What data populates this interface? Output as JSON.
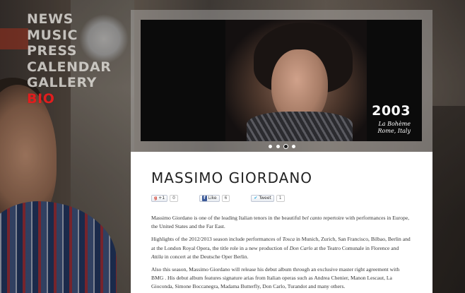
{
  "nav": {
    "items": [
      {
        "label": "NEWS"
      },
      {
        "label": "MUSIC"
      },
      {
        "label": "PRESS"
      },
      {
        "label": "CALENDAR"
      },
      {
        "label": "GALLERY"
      },
      {
        "label": "BIO",
        "active": true
      }
    ]
  },
  "slider": {
    "year": "2003",
    "caption_line1": "La Bohème",
    "caption_line2": "Rome, Italy",
    "dots": 4,
    "active_dot": 3
  },
  "content": {
    "title": "MASSIMO GIORDANO",
    "share": {
      "gplus_label": "+1",
      "gplus_count": "0",
      "facebook_label": "Like",
      "facebook_count": "6",
      "twitter_label": "Tweet",
      "twitter_count": "1"
    },
    "bio": {
      "p1_a": "Massimo Giordano is one of the leading Italian tenors in the beautiful ",
      "p1_em": "bel canto",
      "p1_b": " repertoire with performances in Europe, the United States and the Far East.",
      "p2_a": "Highlights of the 2012/2013 season include performances of ",
      "p2_em1": "Tosca",
      "p2_b": " in Munich, Zurich, San Francisco, Bilbao, Berlin and at the London Royal Opera, the title role in a new production of  ",
      "p2_em2": "Don Carlo",
      "p2_c": " at the Teatro Comunale in Florence and ",
      "p2_em3": "Attila",
      "p2_d": " in concert at the Deutsche Oper Berlin.",
      "p3": "Also this season, Massimo Giordano will release his debut album through an exclusive master right agreement with BMG . His debut album features signature arias from Italian operas such as Andrea Chenier, Manon Lescaut, La Gioconda, Simone Boccanegra, Madama Butterfly, Don Carlo, Turandot and many others."
    }
  },
  "colors": {
    "nav_text": "#ece9e4",
    "nav_active": "#e01e1e",
    "content_bg": "#ffffff",
    "slider_bg": "#0b0b0b"
  }
}
